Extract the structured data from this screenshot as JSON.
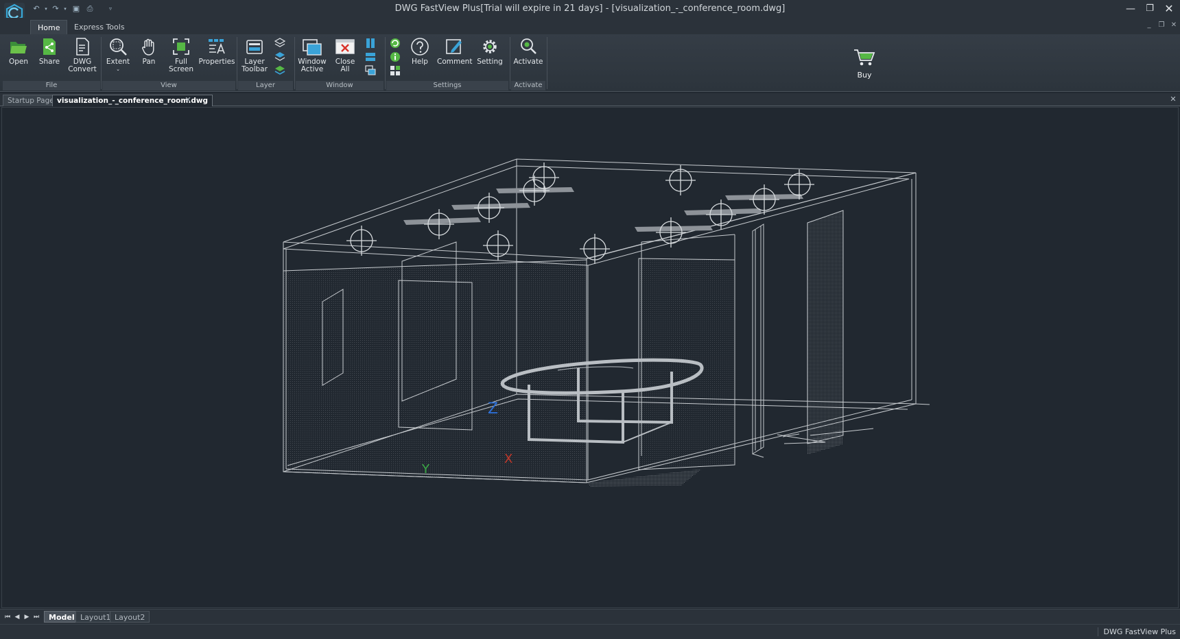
{
  "window": {
    "title": "DWG FastView Plus[Trial will expire in 21 days] - [visualization_-_conference_room.dwg]",
    "minimize_icon": "minimize-icon",
    "restore_icon": "restore-icon",
    "close_icon": "close-icon"
  },
  "ribbon_tabs": [
    "Home",
    "Express Tools"
  ],
  "ribbon": {
    "file": {
      "label": "File",
      "buttons": [
        {
          "label": "Open",
          "icon": "folder-open-icon"
        },
        {
          "label": "Share",
          "icon": "share-icon"
        },
        {
          "label": "DWG\nConvert",
          "icon": "dwg-convert-icon"
        }
      ]
    },
    "view": {
      "label": "View",
      "buttons": [
        {
          "label": "Extent",
          "icon": "zoom-extent-icon"
        },
        {
          "label": "Pan",
          "icon": "hand-icon"
        },
        {
          "label": "Full\nScreen",
          "icon": "fullscreen-icon"
        },
        {
          "label": "Properties",
          "icon": "properties-icon"
        }
      ]
    },
    "layer": {
      "label": "Layer",
      "buttons": [
        {
          "label": "Layer\nToolbar",
          "icon": "layer-toolbar-icon"
        }
      ]
    },
    "window": {
      "label": "Window",
      "buttons": [
        {
          "label": "Window\nActive",
          "icon": "window-active-icon"
        },
        {
          "label": "Close\nAll",
          "icon": "close-all-icon"
        }
      ]
    },
    "settings": {
      "label": "Settings",
      "buttons": [
        {
          "label": "Help",
          "icon": "help-icon"
        },
        {
          "label": "Comment",
          "icon": "comment-icon"
        },
        {
          "label": "Setting",
          "icon": "gear-icon"
        }
      ]
    },
    "activate": {
      "label": "Activate",
      "buttons": [
        {
          "label": "Activate",
          "icon": "activate-search-icon"
        }
      ]
    },
    "buy": {
      "label": "Buy",
      "icon": "cart-icon"
    }
  },
  "doc_tabs": [
    {
      "label": "Startup Page",
      "active": false
    },
    {
      "label": "visualization_-_conference_room.dwg",
      "active": true
    }
  ],
  "drawing": {
    "axis_labels": {
      "z": "Z",
      "y": "Y",
      "x": "X"
    },
    "colors": {
      "background": "#212830",
      "lines": "#c8ccd0",
      "z_axis": "#2d6fd6",
      "y_axis": "#3aa845",
      "x_axis": "#c0392b"
    }
  },
  "layout_tabs": [
    {
      "label": "Model",
      "active": true
    },
    {
      "label": "Layout1",
      "active": false
    },
    {
      "label": "Layout2",
      "active": false
    }
  ],
  "status": {
    "app_name": "DWG FastView Plus"
  }
}
